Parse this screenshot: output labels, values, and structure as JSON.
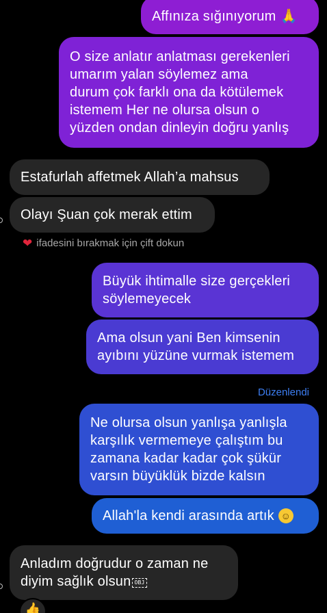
{
  "messages": [
    {
      "id": "m1",
      "side": "out",
      "text": "Affınıza sığınıyorum",
      "emoji": "🙏",
      "color": "#8e1ed3"
    },
    {
      "id": "m2",
      "side": "out",
      "text": "O size anlatır anlatması gerekenleri\numarım yalan söylemez ama\ndurum çok farklı ona da kötülemek\nistemem Her ne olursa olsun o\nyüzden ondan dinleyin doğru yanlış",
      "color": "#7f22d6"
    },
    {
      "id": "m3",
      "side": "in",
      "text": "Estafurlah affetmek Allah’a mahsus"
    },
    {
      "id": "m4",
      "side": "in",
      "text": "Olayı Şuan çok merak ettim"
    },
    {
      "id": "m5",
      "side": "out",
      "text": "Büyük ihtimalle size gerçekleri\nsöylemeyecek",
      "color": "#5a34d4"
    },
    {
      "id": "m6",
      "side": "out",
      "text": "Ama olsun yani Ben kimsenin\nayıbını yüzüne vurmak istemem",
      "color": "#4a3bd2"
    },
    {
      "id": "m7",
      "side": "out",
      "text": "Ne olursa olsun  yanlışa yanlışla\nkarşılık vermemeye çalıştım bu\nzamana kadar kadar çok şükür\nvarsın büyüklük bizde kalsın",
      "color": "#2f4fd2"
    },
    {
      "id": "m8",
      "side": "out",
      "text": "Allah'la kendi arasında artık",
      "emoji": "🙂",
      "color": "#1f5fd4"
    },
    {
      "id": "m9",
      "side": "in",
      "text": "Anladım doğrudur o zaman ne\ndiyim sağlık olsun",
      "object_placeholder": "OBJ"
    }
  ],
  "react_hint": {
    "icon": "heart-icon",
    "text": "ifadesini bırakmak için çift dokun"
  },
  "edited_label": "Düzenlendi",
  "reaction": {
    "icon": "thumbs-up-icon",
    "glyph": "👍"
  }
}
